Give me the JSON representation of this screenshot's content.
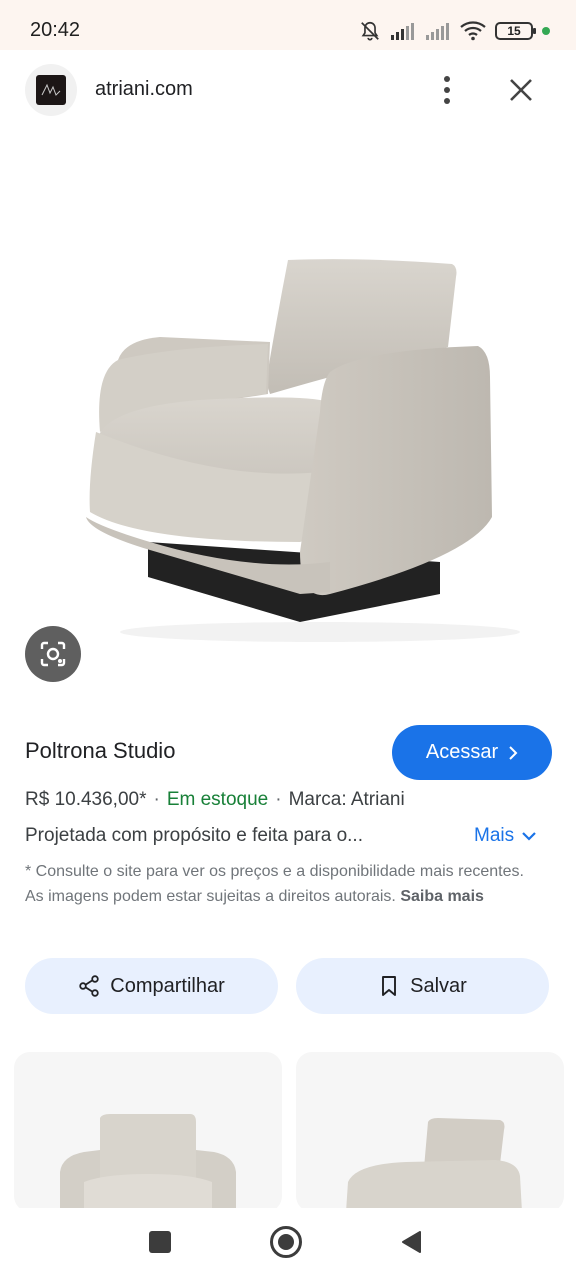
{
  "status_bar": {
    "time": "20:42",
    "battery": "15"
  },
  "site": {
    "name": "atriani.com"
  },
  "product": {
    "title": "Poltrona Studio",
    "visit_label": "Acessar",
    "price": "R$ 10.436,00*",
    "stock": "Em estoque",
    "brand": "Marca: Atriani",
    "description": "Projetada com propósito e feita para o...",
    "more_label": "Mais",
    "disclaimer": "* Consulte o site para ver os preços e a disponibilidade mais recentes. As imagens podem estar sujeitas a direitos autorais.",
    "learn_more": "Saiba mais"
  },
  "actions": {
    "share_label": "Compartilhar",
    "save_label": "Salvar"
  },
  "colors": {
    "accent": "#1a73e8",
    "stock": "#188038",
    "chip_bg": "#e8f0fe"
  },
  "icons": [
    "bell-off-icon",
    "signal-icon",
    "wifi-icon",
    "battery-icon",
    "more-vert-icon",
    "close-icon",
    "lens-icon",
    "chevron-right-icon",
    "chevron-down-icon",
    "share-icon",
    "bookmark-icon",
    "recents-icon",
    "home-icon",
    "back-icon"
  ]
}
